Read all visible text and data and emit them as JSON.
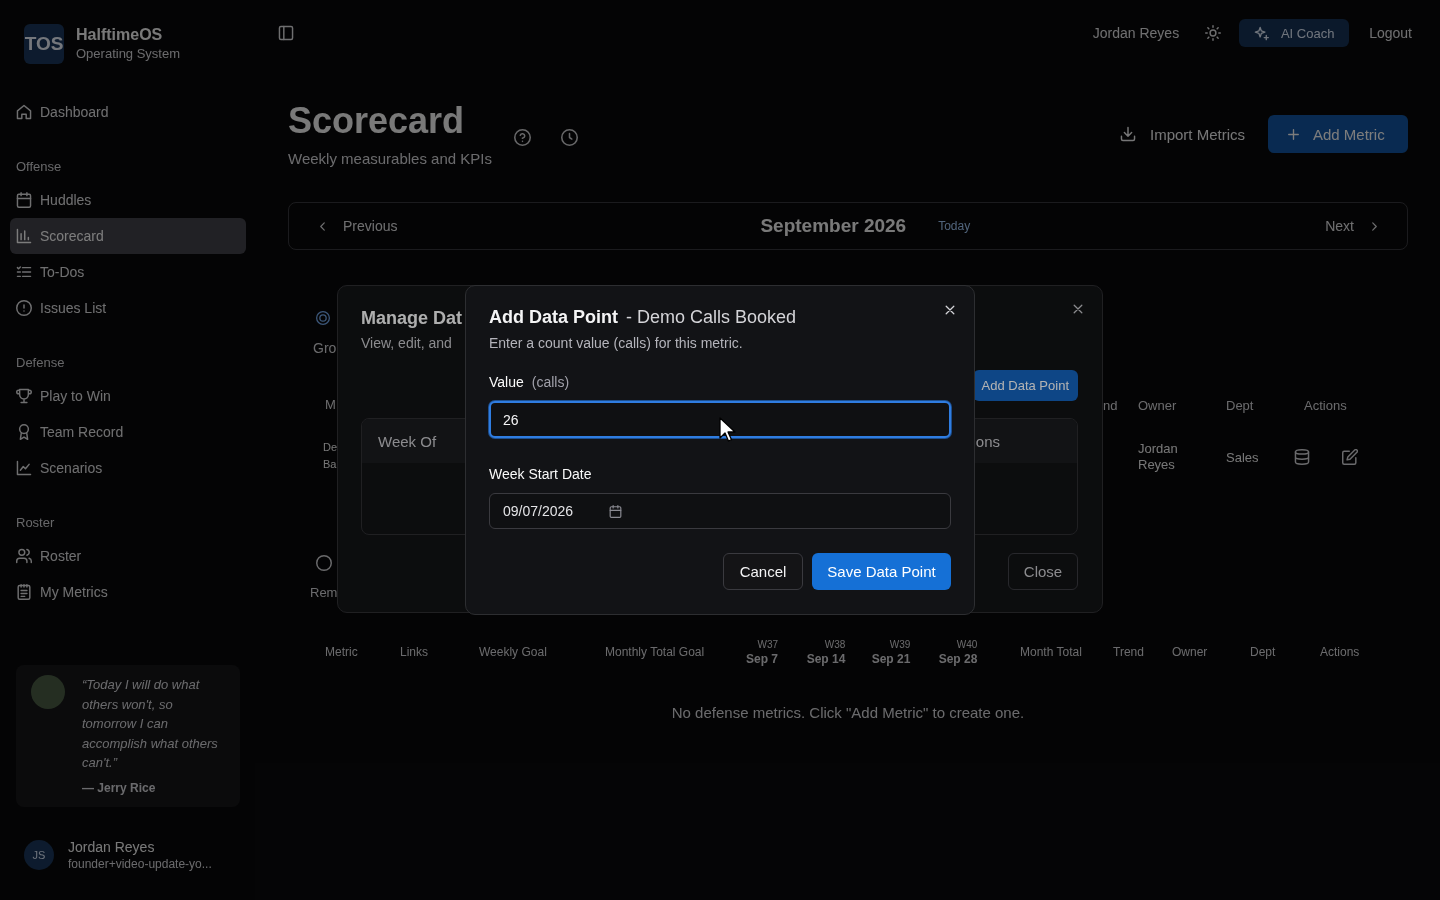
{
  "sidebar": {
    "logo": "TOS",
    "app_name": "HalftimeOS",
    "tagline": "Operating System",
    "top_items": [
      {
        "label": "Dashboard",
        "selected": false
      }
    ],
    "groups": [
      {
        "heading": "Offense",
        "items": [
          {
            "label": "Huddles",
            "selected": false
          },
          {
            "label": "Scorecard",
            "selected": true
          },
          {
            "label": "To-Dos",
            "selected": false
          },
          {
            "label": "Issues List",
            "selected": false
          }
        ]
      },
      {
        "heading": "Defense",
        "items": [
          {
            "label": "Play to Win",
            "selected": false
          },
          {
            "label": "Team Record",
            "selected": false
          },
          {
            "label": "Scenarios",
            "selected": false
          }
        ]
      },
      {
        "heading": "Roster",
        "items": [
          {
            "label": "Roster",
            "selected": false
          },
          {
            "label": "My Metrics",
            "selected": false
          }
        ]
      }
    ],
    "quote": {
      "text": "“Today I will do what others won't, so tomorrow I can accomplish what others can't.”",
      "author": "— Jerry Rice"
    },
    "user": {
      "initials": "JS",
      "name": "Jordan Reyes",
      "email": "founder+video-update-yo..."
    }
  },
  "top_bar": {
    "user_name": "Jordan Reyes",
    "ai_button": "AI Coach",
    "logout": "Logout"
  },
  "header": {
    "title": "Scorecard",
    "subtitle": "Weekly measurables and KPIs",
    "import_button": "Import Metrics",
    "add_button": "Add Metric"
  },
  "week_nav": {
    "previous": "Previous",
    "month": "September 2026",
    "today": "Today",
    "next": "Next"
  },
  "offense_table": {
    "title": "Gro",
    "column_1": "M",
    "metric_cell": "De Ba",
    "footer_text": "Rem",
    "column_fragment": "nd",
    "columns": [
      "Owner",
      "Dept",
      "Actions"
    ],
    "row": {
      "owner": "Jordan Reyes",
      "dept": "Sales"
    }
  },
  "manage_dialog": {
    "title": "Manage Dat",
    "subtitle": "View, edit, and",
    "add_button": "Add Data Point",
    "columns": [
      "Week Of",
      "ons"
    ],
    "close_button": "Close"
  },
  "add_dialog": {
    "title": "Add Data Point",
    "metric": "- Demo Calls Booked",
    "description": "Enter a count value (calls) for this metric.",
    "value_field": {
      "label": "Value",
      "unit": "(calls)",
      "value": "26",
      "focused": true
    },
    "date_field": {
      "label": "Week Start Date",
      "value": "09/07/2026"
    },
    "buttons": {
      "cancel": "Cancel",
      "save": "Save Data Point"
    }
  },
  "defense_table": {
    "columns": [
      {
        "kind": "text",
        "label": "Metric"
      },
      {
        "kind": "text",
        "label": "Links"
      },
      {
        "kind": "text",
        "label": "Weekly Goal"
      },
      {
        "kind": "text",
        "label": "Monthly Total Goal"
      },
      {
        "kind": "week",
        "week": "W37",
        "label": "Sep 7"
      },
      {
        "kind": "week",
        "week": "W38",
        "label": "Sep 14"
      },
      {
        "kind": "week",
        "week": "W39",
        "label": "Sep 21"
      },
      {
        "kind": "week",
        "week": "W40",
        "label": "Sep 28"
      },
      {
        "kind": "text",
        "label": "Month Total"
      },
      {
        "kind": "text",
        "label": "Trend"
      },
      {
        "kind": "text",
        "label": "Owner"
      },
      {
        "kind": "text",
        "label": "Dept"
      },
      {
        "kind": "text",
        "label": "Actions"
      }
    ],
    "empty_message": "No defense metrics. Click \"Add Metric\" to create one."
  }
}
